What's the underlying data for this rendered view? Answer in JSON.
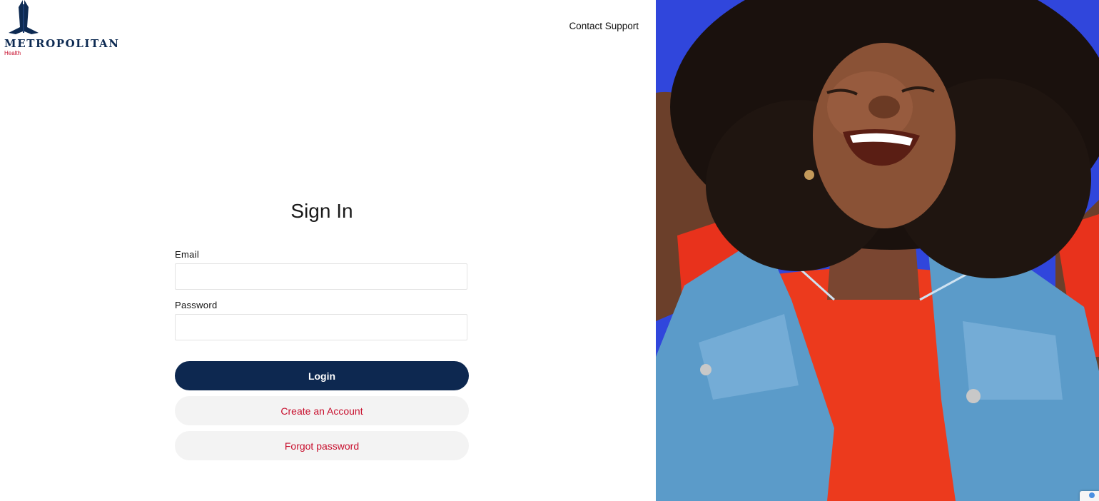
{
  "brand": {
    "name": "METROPOLITAN",
    "sub": "Health",
    "primary_color": "#0d2850",
    "accent_color": "#c8102e"
  },
  "header": {
    "contact_label": "Contact Support"
  },
  "form": {
    "title": "Sign In",
    "email_label": "Email",
    "email_value": "",
    "password_label": "Password",
    "password_value": "",
    "login_label": "Login",
    "create_account_label": "Create an Account",
    "forgot_password_label": "Forgot password"
  },
  "hero": {
    "icon": "hero-photo-icon"
  }
}
